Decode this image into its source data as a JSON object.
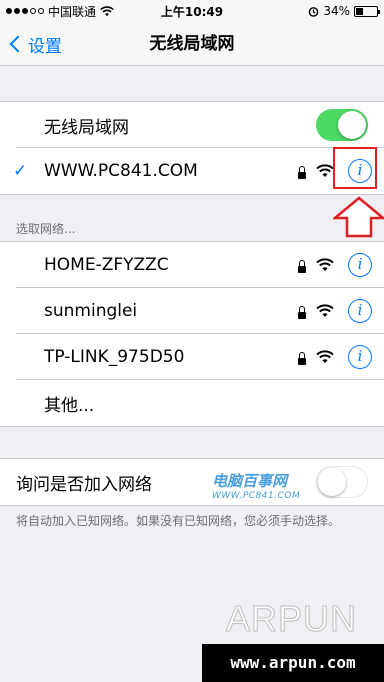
{
  "status_bar": {
    "carrier": "中国联通",
    "time": "上午10:49",
    "battery": "34%",
    "battery_level": 0.34
  },
  "nav": {
    "back_label": "设置",
    "title": "无线局域网"
  },
  "wifi_toggle": {
    "label": "无线局域网",
    "on": true
  },
  "connected_network": {
    "check": "✓",
    "name": "WWW.PC841.COM",
    "locked": true
  },
  "choose_header": "选取网络...",
  "networks": [
    {
      "name": "HOME-ZFYZZC",
      "locked": true
    },
    {
      "name": "sunminglei",
      "locked": true
    },
    {
      "name": "TP-LINK_975D50",
      "locked": true
    }
  ],
  "other_label": "其他...",
  "ask_to_join": {
    "label": "询问是否加入网络",
    "on": false
  },
  "ask_footer": "将自动加入已知网络。如果没有已知网络，您必须手动选择。",
  "info_glyph": "i",
  "watermark": {
    "brand": "电脑百事网",
    "url": "WWW.PC841.COM",
    "arpun": "ARPUN",
    "site": "www.arpun.com"
  },
  "colors": {
    "accent": "#007aff",
    "toggle_on": "#4cd964",
    "highlight": "#e02020"
  }
}
